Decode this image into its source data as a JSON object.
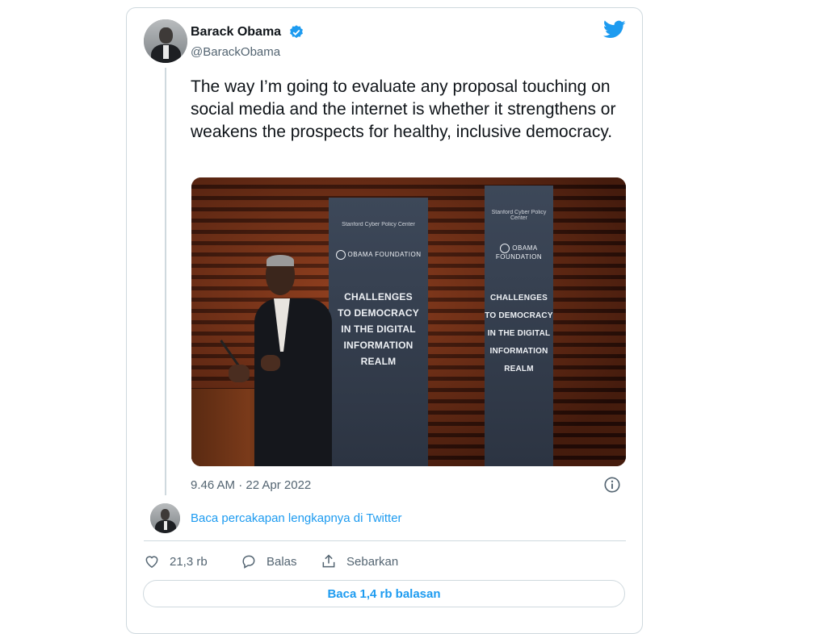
{
  "tweet": {
    "author_name": "Barack Obama",
    "author_handle": "@BarackObama",
    "text": "The way I’m going to evaluate any proposal touching on social media and the internet is whether it strengthens or weakens the prospects for healthy, inclusive democracy.",
    "timestamp": "9.46 AM · 22 Apr 2022",
    "icons": {
      "verified": "verified-badge-icon",
      "brand": "twitter-bird-icon",
      "info": "info-icon",
      "like": "heart-icon",
      "reply": "reply-bubble-icon",
      "share": "share-icon"
    },
    "colors": {
      "accent": "#1d9bf0",
      "muted": "#536471",
      "border": "#cfd9de"
    }
  },
  "media": {
    "banner_sponsor": "Stanford Cyber Policy Center",
    "banner_org": "OBAMA FOUNDATION",
    "banner_headline_lines": [
      "CHALLENGES",
      "TO DEMOCRACY",
      "IN THE DIGITAL",
      "INFORMATION",
      "REALM"
    ]
  },
  "conversation": {
    "link_text": "Baca percakapan lengkapnya di Twitter"
  },
  "actions": {
    "like_count": "21,3 rb",
    "reply_label": "Balas",
    "share_label": "Sebarkan"
  },
  "replies_button": {
    "label": "Baca 1,4 rb balasan"
  }
}
